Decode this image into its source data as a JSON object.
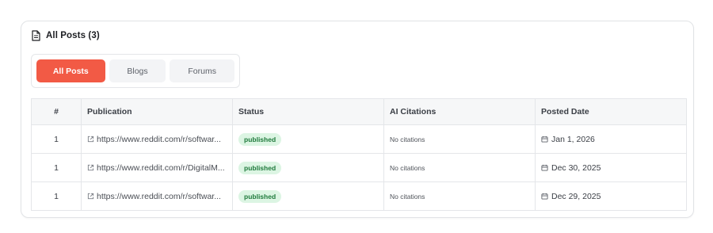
{
  "header": {
    "title": "All Posts (3)",
    "icon": "document-icon"
  },
  "tabs": [
    {
      "label": "All Posts",
      "active": true
    },
    {
      "label": "Blogs",
      "active": false
    },
    {
      "label": "Forums",
      "active": false
    }
  ],
  "table": {
    "columns": [
      "#",
      "Publication",
      "Status",
      "AI Citations",
      "Posted Date"
    ],
    "rows": [
      {
        "num": "1",
        "publication": "https://www.reddit.com/r/softwar...",
        "status": "published",
        "citations": "No citations",
        "date": "Jan 1, 2026"
      },
      {
        "num": "1",
        "publication": "https://www.reddit.com/r/DigitalM...",
        "status": "published",
        "citations": "No citations",
        "date": "Dec 30, 2025"
      },
      {
        "num": "1",
        "publication": "https://www.reddit.com/r/softwar...",
        "status": "published",
        "citations": "No citations",
        "date": "Dec 29, 2025"
      }
    ]
  },
  "colors": {
    "accent": "#f25a45",
    "badge_bg": "#dcf5e3",
    "badge_text": "#1f7a3c"
  }
}
